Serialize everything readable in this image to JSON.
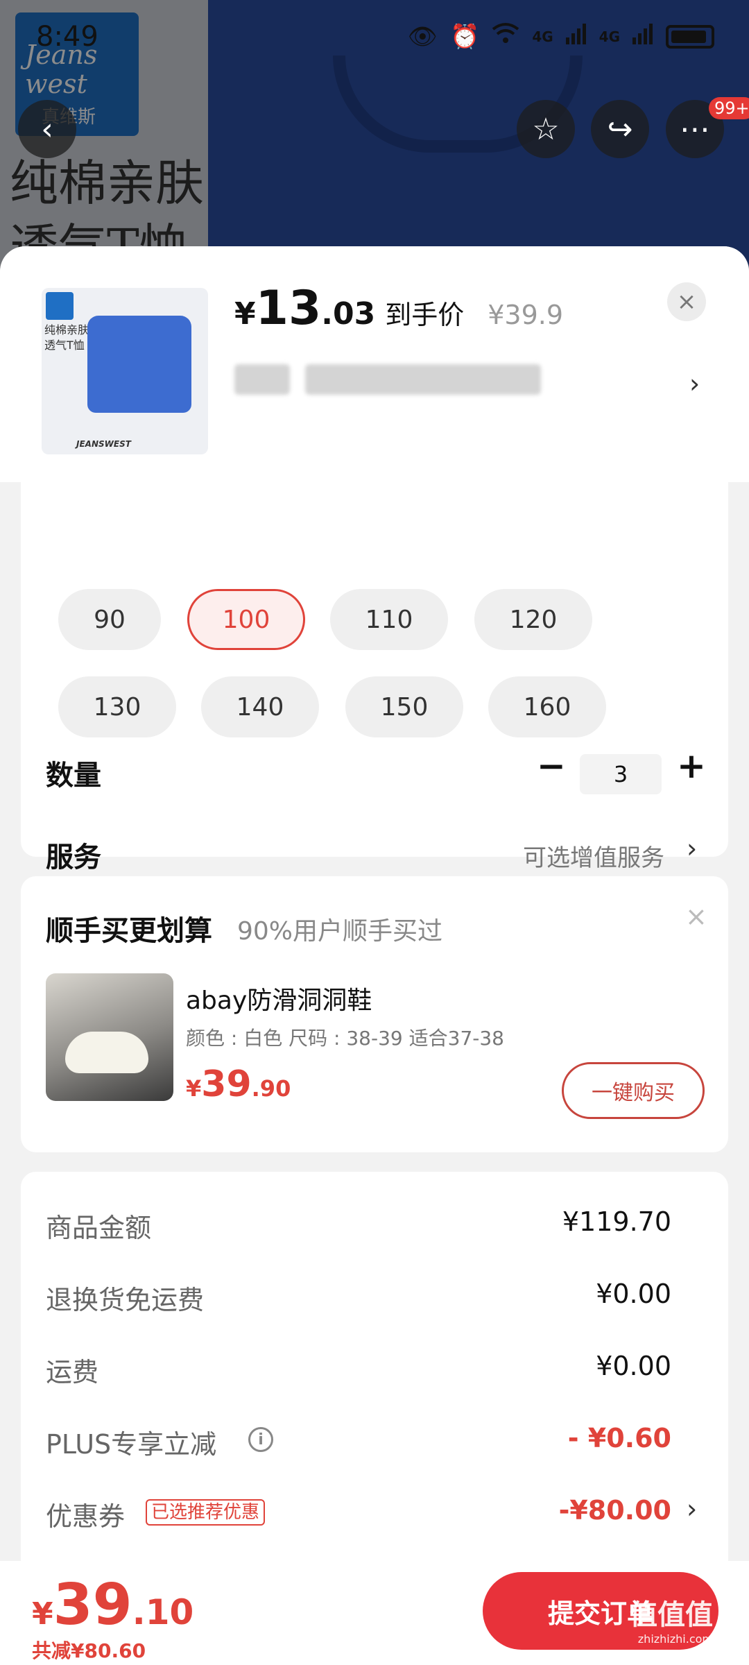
{
  "status_bar": {
    "time": "8:49",
    "net1": "4G",
    "net2": "4G"
  },
  "background": {
    "brand_en": "Jeans west",
    "brand_cn": "真维斯",
    "headline_line1": "纯棉亲肤",
    "headline_line2": "透气T恤"
  },
  "nav": {
    "more_badge": "99+"
  },
  "product": {
    "thumb_text": "纯棉亲肤透气T恤",
    "thumb_footer": "JEANSWEST",
    "price_currency": "¥",
    "price_int": "13",
    "price_dec": ".03",
    "price_label": "到手价",
    "orig_price": "¥39.9"
  },
  "sizes": {
    "options": [
      "90",
      "100",
      "110",
      "120",
      "130",
      "140",
      "150",
      "160"
    ],
    "selected": "100"
  },
  "quantity": {
    "label": "数量",
    "value": "3",
    "minus": "−",
    "plus": "+"
  },
  "service": {
    "label": "服务",
    "value": "可选增值服务"
  },
  "addon": {
    "title": "顺手买更划算",
    "subtitle": "90%用户顺手买过",
    "name": "abay防滑洞洞鞋",
    "spec": "颜色 : 白色    尺码 : 38-39 适合37-38",
    "price_currency": "¥",
    "price_int": "39",
    "price_dec": ".90",
    "buy_label": "一键购买"
  },
  "summary": {
    "rows": [
      {
        "label": "商品金额",
        "value": "¥119.70"
      },
      {
        "label": "退换货免运费",
        "value": "¥0.00"
      },
      {
        "label": "运费",
        "value": "¥0.00"
      },
      {
        "label": "PLUS专享立减",
        "value": "- ¥0.60"
      },
      {
        "label": "优惠券",
        "value": "-¥80.00",
        "tag": "已选推荐优惠"
      }
    ]
  },
  "footer": {
    "total_currency": "¥",
    "total_int": "39",
    "total_dec": ".10",
    "saved": "共减¥80.60",
    "submit": "提交订单",
    "watermark": "值值值",
    "watermark_url": "zhizhizhi.com"
  },
  "colors": {
    "accent": "#e0433a",
    "button": "#e8323a"
  }
}
